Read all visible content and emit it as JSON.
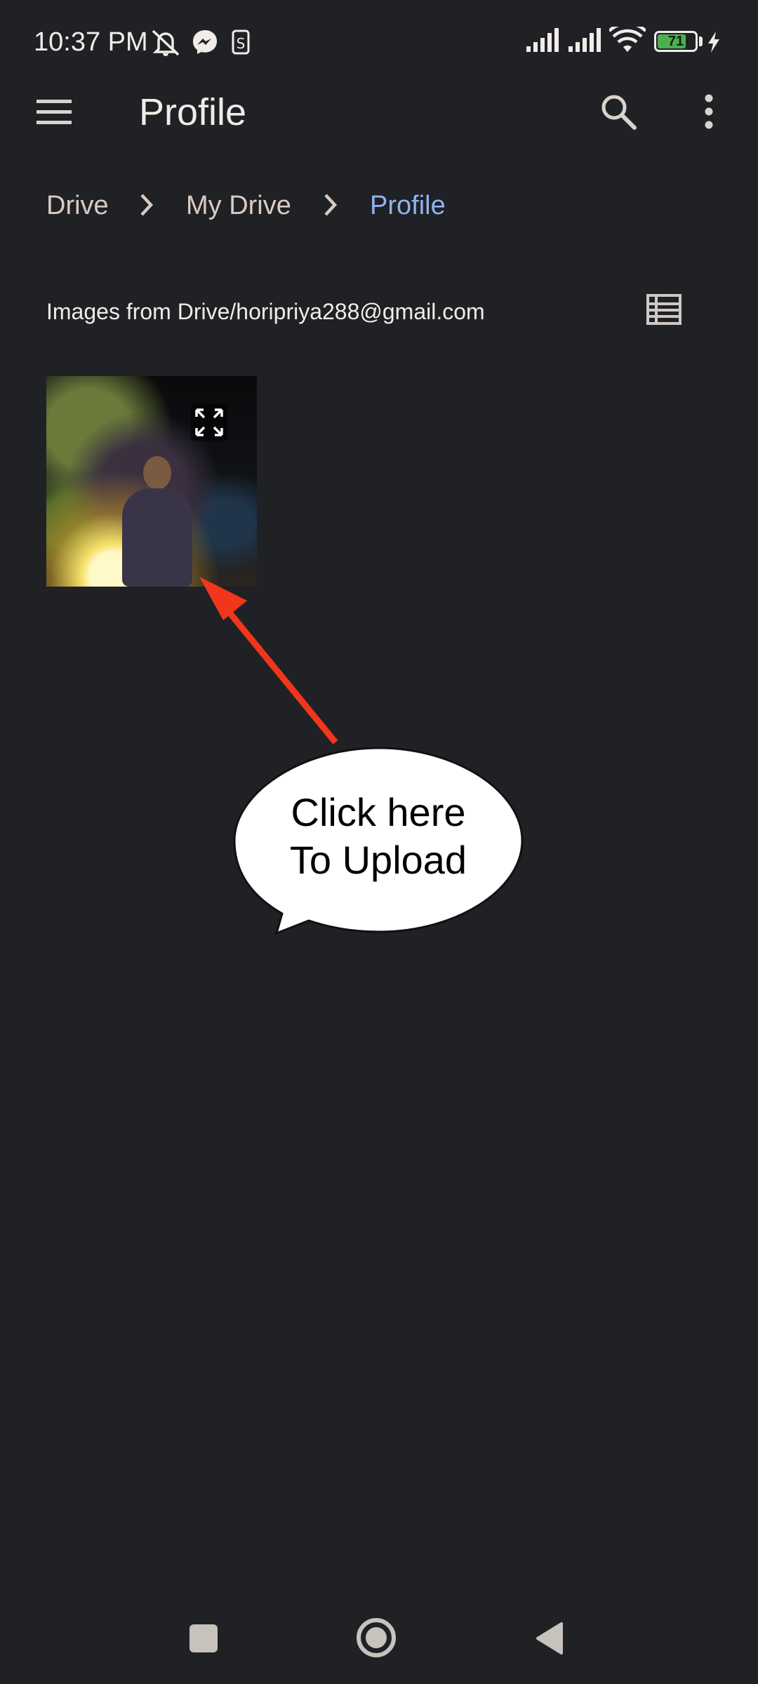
{
  "status_bar": {
    "time": "10:37 PM",
    "battery_level": "71",
    "icons": [
      "do-not-disturb-icon",
      "messenger-icon",
      "sim-icon",
      "signal-icon",
      "signal-icon",
      "wifi-icon",
      "battery-icon",
      "charging-icon"
    ]
  },
  "app_bar": {
    "title": "Profile",
    "icons": [
      "menu-icon",
      "search-icon",
      "more-vert-icon"
    ]
  },
  "breadcrumb": {
    "items": [
      "Drive",
      "My Drive",
      "Profile"
    ]
  },
  "section": {
    "label": "Images from Drive/horipriya288@gmail.com",
    "view_toggle_icon": "list-view-icon"
  },
  "thumbnail": {
    "overlay_icon": "expand-icon"
  },
  "annotation": {
    "line1": "Click here",
    "line2": "To Upload",
    "arrow_color": "#f2361c"
  },
  "nav_bar": {
    "icons": [
      "recents-icon",
      "home-icon",
      "back-icon"
    ]
  },
  "colors": {
    "background": "#202125",
    "breadcrumb_active": "#8fb3ef",
    "battery": "#4caf50"
  }
}
